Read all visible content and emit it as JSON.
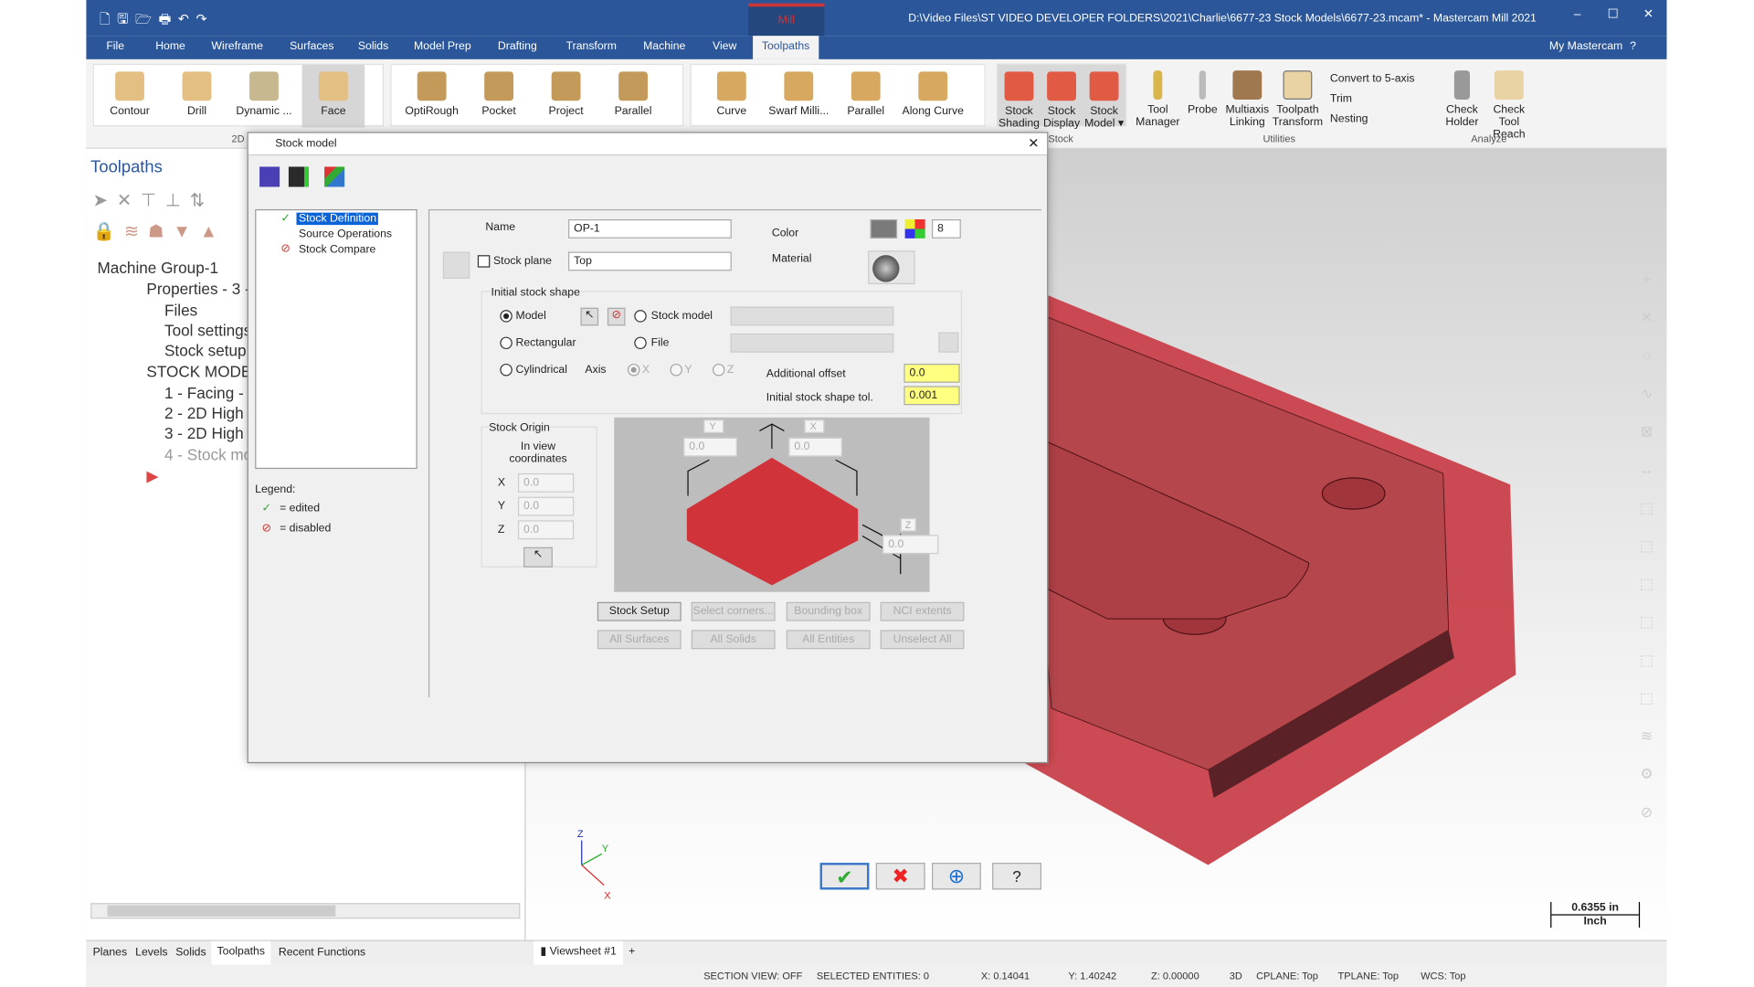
{
  "title": "D:\\Video Files\\ST VIDEO DEVELOPER FOLDERS\\2021\\Charlie\\6677-23 Stock Models\\6677-23.mcam* - Mastercam Mill 2021",
  "context_tab": "Mill",
  "menu_tabs": [
    "File",
    "Home",
    "Wireframe",
    "Surfaces",
    "Solids",
    "Model Prep",
    "Drafting",
    "Transform",
    "Machine",
    "View",
    "Toolpaths"
  ],
  "my_mastercam": "My Mastercam",
  "ribbon": {
    "g2d": [
      "Contour",
      "Drill",
      "Dynamic ...",
      "Face"
    ],
    "g3d": [
      "OptiRough",
      "Pocket",
      "Project",
      "Parallel"
    ],
    "gmulti": [
      "Curve",
      "Swarf Milli...",
      "Parallel",
      "Along Curve"
    ],
    "stock": [
      "Stock Shading",
      "Stock Display",
      "Stock Model ▾"
    ],
    "util": [
      "Tool Manager",
      "Probe",
      "Multiaxis Linking",
      "Toolpath Transform"
    ],
    "util_small": [
      "Convert to 5-axis",
      "Trim",
      "Nesting"
    ],
    "analyze": [
      "Check Holder",
      "Check Tool Reach"
    ],
    "groups": {
      "g2d": "2D",
      "stock": "Stock",
      "util": "Utilities",
      "analyze": "Analyze"
    }
  },
  "left_panel": {
    "title": "Toolpaths",
    "tree": [
      "Machine Group-1",
      "Properties - 3 -",
      "Files",
      "Tool settings",
      "Stock setup",
      "STOCK MODEL",
      "1 - Facing -",
      "2 - 2D High",
      "3 - 2D High",
      "4 - Stock mo"
    ]
  },
  "bottom_tabs": [
    "Planes",
    "Levels",
    "Solids",
    "Toolpaths",
    "Recent Functions"
  ],
  "viewsheet": "Viewsheet #1",
  "scale_bar": {
    "value": "0.6355 in",
    "unit": "Inch"
  },
  "status": {
    "section": "SECTION VIEW: OFF",
    "selected": "SELECTED ENTITIES: 0",
    "x": "X:  0.14041",
    "y": "Y:  1.40242",
    "z": "Z:  0.00000",
    "mode": "3D",
    "cplane": "CPLANE: Top",
    "tplane": "TPLANE: Top",
    "wcs": "WCS: Top"
  },
  "dialog": {
    "title": "Stock model",
    "nav": [
      "Stock Definition",
      "Source Operations",
      "Stock Compare"
    ],
    "legend": {
      "title": "Legend:",
      "edited": "= edited",
      "disabled": "= disabled"
    },
    "name_label": "Name",
    "name_value": "OP-1",
    "color_label": "Color",
    "color_value": "8",
    "color_swatch": "#7a7a7a",
    "stock_plane_label": "Stock plane",
    "stock_plane_value": "Top",
    "material_label": "Material",
    "initial_shape": "Initial stock shape",
    "shape_options": {
      "model": "Model",
      "rectangular": "Rectangular",
      "cylindrical": "Cylindrical",
      "stock_model": "Stock model",
      "file": "File"
    },
    "selected_shape": "Model",
    "axis_label": "Axis",
    "axes": [
      "X",
      "Y",
      "Z"
    ],
    "additional_offset_label": "Additional offset",
    "additional_offset": "0.0",
    "tol_label": "Initial stock shape tol.",
    "tol": "0.001",
    "origin": {
      "title": "Stock Origin",
      "subtitle": "In view coordinates",
      "x": "0.0",
      "y": "0.0",
      "z": "0.0"
    },
    "preview": {
      "y_label": "Y",
      "x_label": "X",
      "z_label": "Z",
      "y": "0.0",
      "x": "0.0",
      "z": "0.0"
    },
    "buttons": [
      "Stock Setup",
      "Select corners...",
      "Bounding box",
      "NCI extents",
      "All Surfaces",
      "All Solids",
      "All Entities",
      "Unselect All"
    ]
  },
  "colors": {
    "accent": "#2b579a",
    "stock": "#d0343a"
  }
}
